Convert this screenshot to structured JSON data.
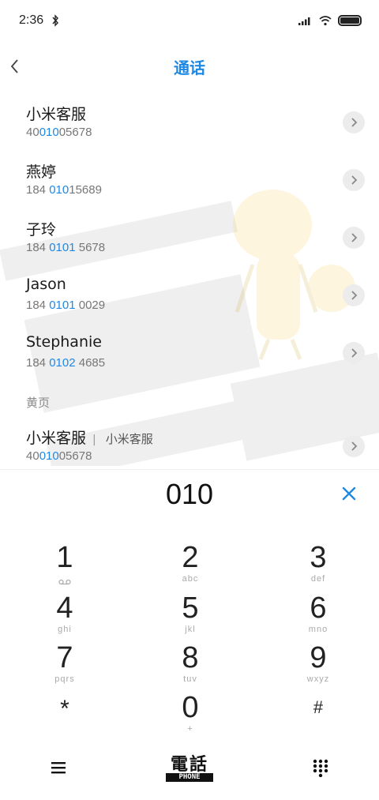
{
  "status_bar": {
    "time": "2:36",
    "icons": [
      "bluetooth-icon",
      "signal-icon",
      "wifi-icon",
      "battery-icon"
    ]
  },
  "header": {
    "title": "通话",
    "back_icon": "chevron-left-icon"
  },
  "contacts": [
    {
      "name": "小米客服",
      "number_pre": "40",
      "number_hl": "010",
      "number_post": "05678"
    },
    {
      "name": "燕婷",
      "number_pre": "184 ",
      "number_hl": "010",
      "number_post": "15689"
    },
    {
      "name": "子玲",
      "number_pre": "184 ",
      "number_hl": "0101",
      "number_post": " 5678"
    },
    {
      "name": "Jason",
      "number_pre": "184 ",
      "number_hl": "0101",
      "number_post": " 0029"
    },
    {
      "name": "Stephanie",
      "number_pre": "184 ",
      "number_hl": "0102",
      "number_post": " 4685"
    }
  ],
  "yellow_pages": {
    "section_label": "黄页",
    "entry": {
      "name": "小米客服",
      "separator": "|",
      "subtitle": "小米客服",
      "number_pre": "40",
      "number_hl": "010",
      "number_post": "05678"
    }
  },
  "dialer": {
    "input": "010",
    "clear_icon": "close-icon"
  },
  "keypad": [
    {
      "digit": "1",
      "letters": ""
    },
    {
      "digit": "2",
      "letters": "abc"
    },
    {
      "digit": "3",
      "letters": "def"
    },
    {
      "digit": "4",
      "letters": "ghi"
    },
    {
      "digit": "5",
      "letters": "jkl"
    },
    {
      "digit": "6",
      "letters": "mno"
    },
    {
      "digit": "7",
      "letters": "pqrs"
    },
    {
      "digit": "8",
      "letters": "tuv"
    },
    {
      "digit": "9",
      "letters": "wxyz"
    },
    {
      "digit": "*",
      "letters": ""
    },
    {
      "digit": "0",
      "letters": "+"
    },
    {
      "digit": "#",
      "letters": ""
    }
  ],
  "bottom_bar": {
    "call_label": "電話",
    "call_sublabel": "PHONE",
    "menu_icon": "menu-icon",
    "keypad_icon": "dialpad-icon"
  },
  "colors": {
    "accent": "#1e88e5",
    "text": "#1a1a1a",
    "secondary": "#777777"
  }
}
